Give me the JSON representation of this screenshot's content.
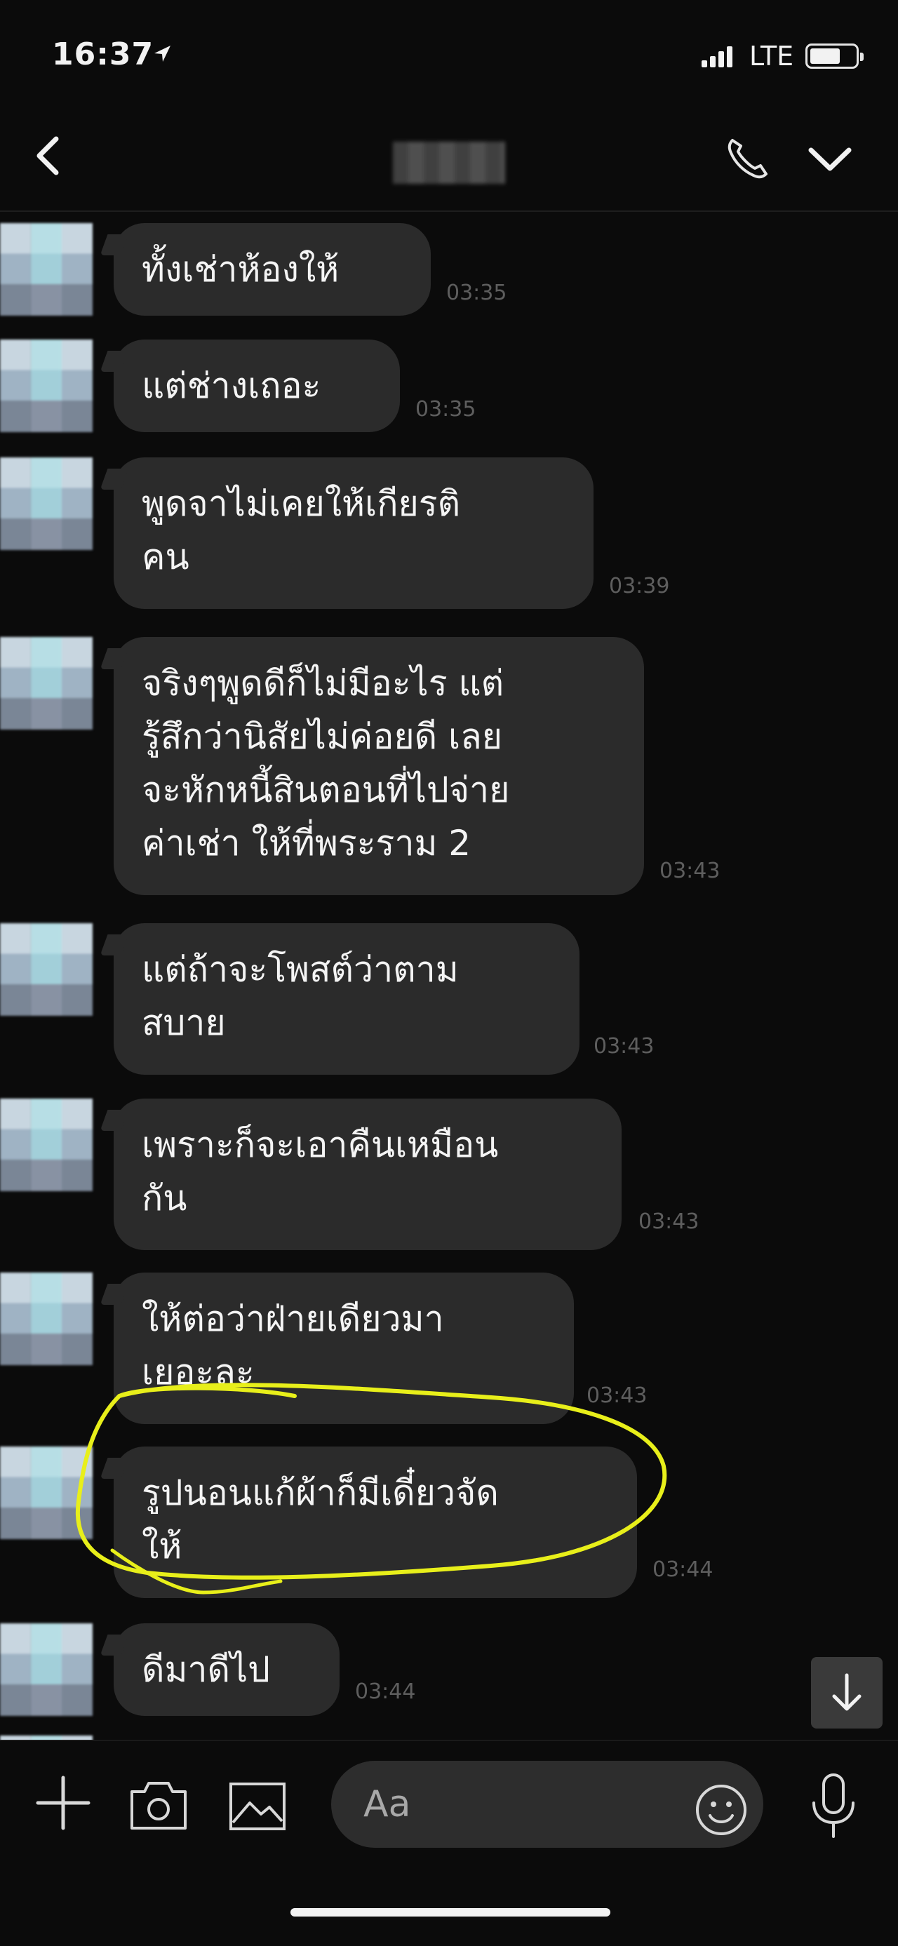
{
  "status_bar": {
    "time": "16:37",
    "network": "LTE"
  },
  "header": {
    "contact_name": ""
  },
  "messages": [
    {
      "text": "ทั้งเช่าห้องให้",
      "time": "03:35"
    },
    {
      "text": "แต่ช่างเถอะ",
      "time": "03:35"
    },
    {
      "text": "พูดจาไม่เคยให้เกียรติ\nคน",
      "time": "03:39"
    },
    {
      "text": "จริงๆพูดดีก็ไม่มีอะไร แต่\nรู้สึกว่านิสัยไม่ค่อยดี เลย\nจะหักหนี้สินตอนที่ไปจ่าย\nค่าเช่า ให้ที่พระราม 2",
      "time": "03:43"
    },
    {
      "text": "แต่ถ้าจะโพสต์ว่าตาม\nสบาย",
      "time": "03:43"
    },
    {
      "text": "เพราะก็จะเอาคืนเหมือน\nกัน",
      "time": "03:43"
    },
    {
      "text": "ให้ต่อว่าฝ่ายเดียวมา\nเยอะละ",
      "time": "03:43"
    },
    {
      "text": "รูปนอนแก้ผ้าก็มีเดี๋ยวจัด\nให้",
      "time": "03:44"
    },
    {
      "text": "ดีมาดีไป",
      "time": "03:44"
    }
  ],
  "input": {
    "placeholder": "Aa"
  },
  "colors": {
    "background": "#0b0b0b",
    "bubble": "#2b2b2b",
    "highlight": "#e8ef1a",
    "timestamp": "#5e5e5e"
  },
  "icons": [
    "back-icon",
    "location-arrow-icon",
    "phone-icon",
    "chevron-down-icon",
    "plus-icon",
    "camera-icon",
    "image-icon",
    "emoji-icon",
    "mic-icon",
    "arrow-down-icon"
  ]
}
